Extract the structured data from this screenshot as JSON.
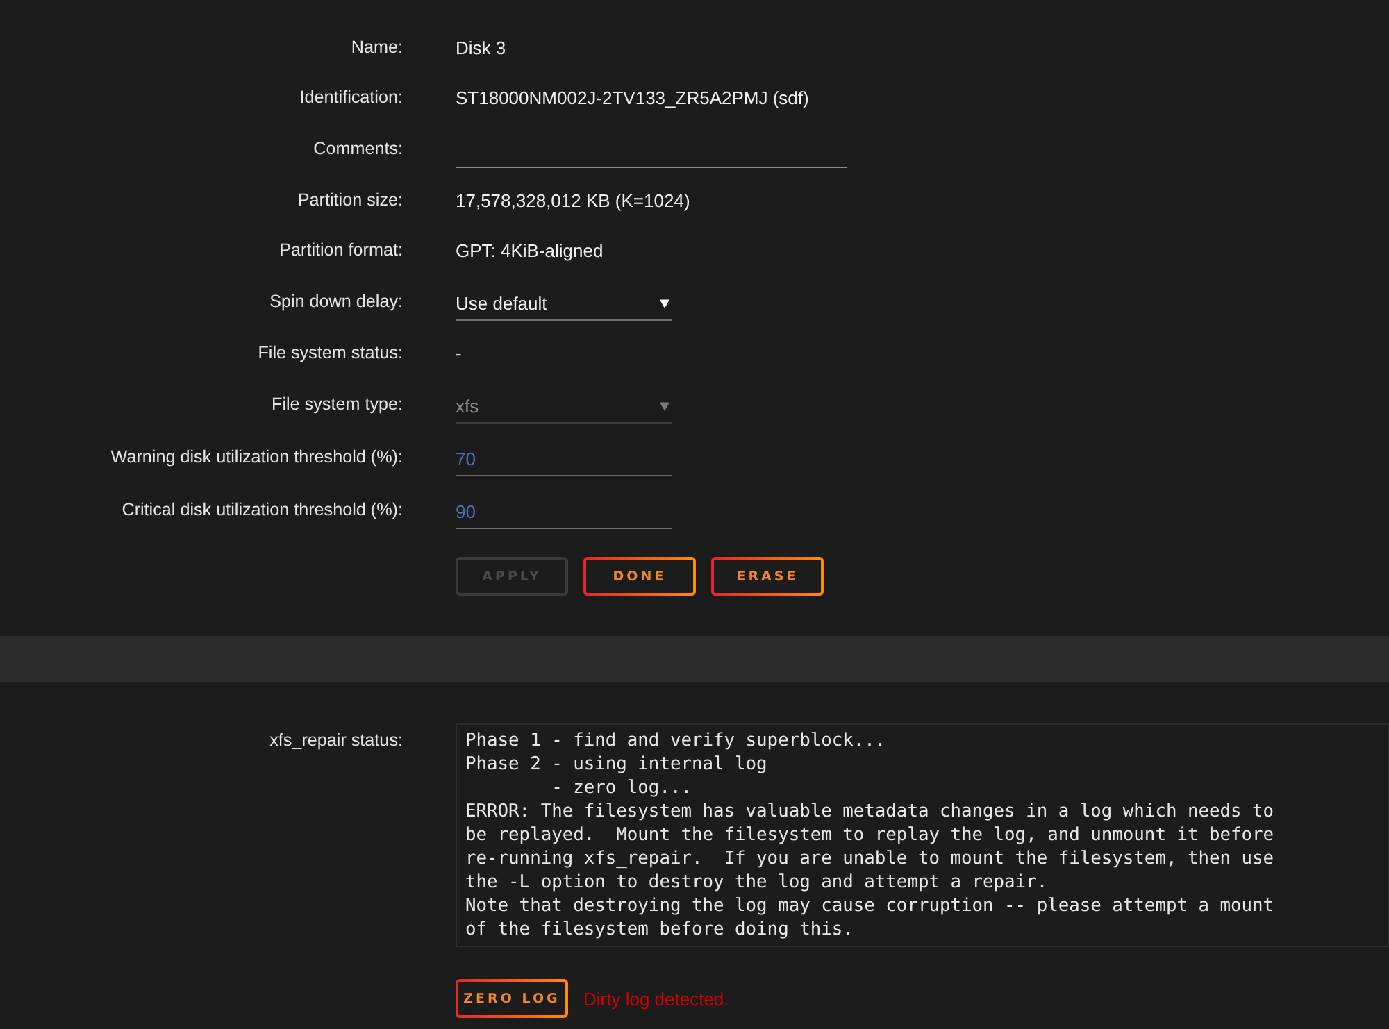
{
  "settings": {
    "fields": [
      {
        "label": "Name:",
        "kind": "text",
        "value": "Disk 3"
      },
      {
        "label": "Identification:",
        "kind": "text",
        "value": "ST18000NM002J-2TV133_ZR5A2PMJ (sdf)"
      },
      {
        "label": "Comments:",
        "kind": "input"
      },
      {
        "label": "Partition size:",
        "kind": "text",
        "value": "17,578,328,012 KB (K=1024)"
      },
      {
        "label": "Partition format:",
        "kind": "text",
        "value": "GPT: 4KiB-aligned"
      },
      {
        "label": "Spin down delay:",
        "kind": "select",
        "value": "Use default",
        "disabled": false
      },
      {
        "label": "File system status:",
        "kind": "text",
        "value": "-"
      },
      {
        "label": "File system type:",
        "kind": "select",
        "value": "xfs",
        "disabled": true
      },
      {
        "label": "Warning disk utilization threshold (%):",
        "kind": "number",
        "value": "70"
      },
      {
        "label": "Critical disk utilization threshold (%):",
        "kind": "number",
        "value": "90"
      }
    ],
    "buttons": [
      {
        "label": "APPLY",
        "disabled": true
      },
      {
        "label": "DONE",
        "disabled": false
      },
      {
        "label": "ERASE",
        "disabled": false
      }
    ]
  },
  "repair": {
    "label": "xfs_repair status:",
    "output": "Phase 1 - find and verify superblock...\nPhase 2 - using internal log\n        - zero log...\nERROR: The filesystem has valuable metadata changes in a log which needs to\nbe replayed.  Mount the filesystem to replay the log, and unmount it before\nre-running xfs_repair.  If you are unable to mount the filesystem, then use\nthe -L option to destroy the log and attempt a repair.\nNote that destroying the log may cause corruption -- please attempt a mount\nof the filesystem before doing this.",
    "button": {
      "label": "ZERO LOG",
      "disabled": false
    },
    "message": "Dirty log detected."
  }
}
